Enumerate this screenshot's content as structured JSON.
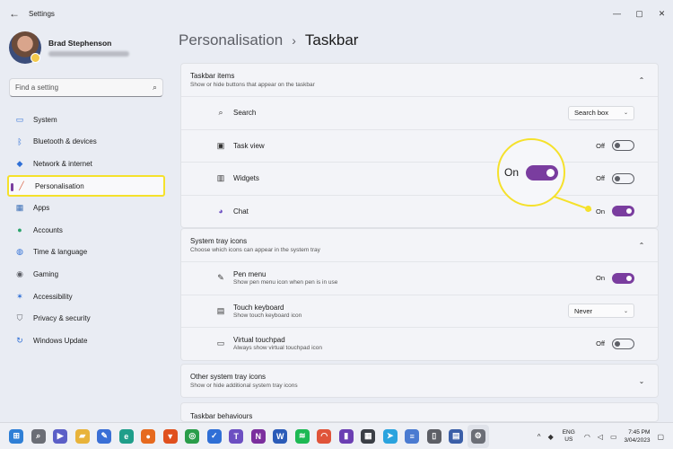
{
  "titlebar": {
    "app_title": "Settings",
    "back_icon": "back-arrow-icon",
    "minimize_glyph": "—",
    "maximize_glyph": "▢",
    "close_glyph": "✕"
  },
  "profile": {
    "name": "Brad Stephenson"
  },
  "search": {
    "placeholder": "Find a setting"
  },
  "sidebar": {
    "items": [
      {
        "label": "System",
        "icon": "monitor-icon",
        "color": "#2f6fd6"
      },
      {
        "label": "Bluetooth & devices",
        "icon": "bluetooth-icon",
        "color": "#2f6fd6"
      },
      {
        "label": "Network & internet",
        "icon": "wifi-icon",
        "color": "#2f6fd6"
      },
      {
        "label": "Personalisation",
        "icon": "brush-icon",
        "color": "#d8664a",
        "active": true
      },
      {
        "label": "Apps",
        "icon": "apps-icon",
        "color": "#3b6fb6"
      },
      {
        "label": "Accounts",
        "icon": "person-icon",
        "color": "#2aa36b"
      },
      {
        "label": "Time & language",
        "icon": "globe-clock-icon",
        "color": "#2f6fd6"
      },
      {
        "label": "Gaming",
        "icon": "controller-icon",
        "color": "#5d5f66"
      },
      {
        "label": "Accessibility",
        "icon": "accessibility-icon",
        "color": "#2f6fd6"
      },
      {
        "label": "Privacy & security",
        "icon": "shield-icon",
        "color": "#5d5f66"
      },
      {
        "label": "Windows Update",
        "icon": "update-icon",
        "color": "#2f6fd6"
      }
    ]
  },
  "breadcrumb": {
    "parent": "Personalisation",
    "separator": "›",
    "current": "Taskbar"
  },
  "taskbar_items": {
    "title": "Taskbar items",
    "subtitle": "Show or hide buttons that appear on the taskbar",
    "rows": [
      {
        "label": "Search",
        "icon": "search-icon",
        "dropdown": "Search box"
      },
      {
        "label": "Task view",
        "icon": "task-view-icon",
        "state": "Off",
        "on": false
      },
      {
        "label": "Widgets",
        "icon": "widgets-icon",
        "state": "Off",
        "on": false
      },
      {
        "label": "Chat",
        "icon": "chat-icon",
        "state": "On",
        "on": true
      }
    ]
  },
  "system_tray": {
    "title": "System tray icons",
    "subtitle": "Choose which icons can appear in the system tray",
    "rows": [
      {
        "label": "Pen menu",
        "sub": "Show pen menu icon when pen is in use",
        "icon": "pen-icon",
        "state": "On",
        "on": true
      },
      {
        "label": "Touch keyboard",
        "sub": "Show touch keyboard icon",
        "icon": "keyboard-icon",
        "dropdown": "Never"
      },
      {
        "label": "Virtual touchpad",
        "sub": "Always show virtual touchpad icon",
        "icon": "touchpad-icon",
        "state": "Off",
        "on": false
      }
    ]
  },
  "other_tray": {
    "title": "Other system tray icons",
    "subtitle": "Show or hide additional system tray icons"
  },
  "behaviours": {
    "title": "Taskbar behaviours"
  },
  "callout": {
    "text": "On"
  },
  "taskbar": {
    "apps": [
      {
        "name": "start-icon",
        "glyph": "⊞",
        "color": "#2f7fd6"
      },
      {
        "name": "search-icon",
        "glyph": "⌕",
        "color": "#6b6e76"
      },
      {
        "name": "meet-icon",
        "glyph": "▶",
        "color": "#5b5fc7"
      },
      {
        "name": "file-explorer-icon",
        "glyph": "▰",
        "color": "#e8b33a"
      },
      {
        "name": "pen-app-icon",
        "glyph": "✎",
        "color": "#3a6fd6"
      },
      {
        "name": "edge-icon",
        "glyph": "e",
        "color": "#1f9e8a"
      },
      {
        "name": "firefox-icon",
        "glyph": "●",
        "color": "#e66a1f"
      },
      {
        "name": "brave-icon",
        "glyph": "▼",
        "color": "#e0501e"
      },
      {
        "name": "chrome-icon",
        "glyph": "◎",
        "color": "#2a9d4a"
      },
      {
        "name": "todo-icon",
        "glyph": "✓",
        "color": "#2f6fd6"
      },
      {
        "name": "teams-icon",
        "glyph": "T",
        "color": "#6c4fc2"
      },
      {
        "name": "onenote-icon",
        "glyph": "N",
        "color": "#7b2f9e"
      },
      {
        "name": "word-icon",
        "glyph": "W",
        "color": "#2b5bb8"
      },
      {
        "name": "spotify-icon",
        "glyph": "≋",
        "color": "#1db954"
      },
      {
        "name": "headphones-app-icon",
        "glyph": "◠",
        "color": "#e0543a"
      },
      {
        "name": "media-app-icon",
        "glyph": "▮",
        "color": "#6b3fb3"
      },
      {
        "name": "tiles-app-icon",
        "glyph": "▦",
        "color": "#3b3f46"
      },
      {
        "name": "telegram-icon",
        "glyph": "➤",
        "color": "#2aa3de"
      },
      {
        "name": "notepad-icon",
        "glyph": "≡",
        "color": "#4b7bd1"
      },
      {
        "name": "usb-app-icon",
        "glyph": "▯",
        "color": "#5d5f66"
      },
      {
        "name": "store-icon",
        "glyph": "▤",
        "color": "#3b5fa8"
      },
      {
        "name": "settings-icon",
        "glyph": "⚙",
        "color": "#6b6e76",
        "active": true
      }
    ],
    "tray": {
      "chevron": "^",
      "language_top": "ENG",
      "language_bottom": "US",
      "time": "7:45 PM",
      "date": "3/04/2023"
    }
  }
}
